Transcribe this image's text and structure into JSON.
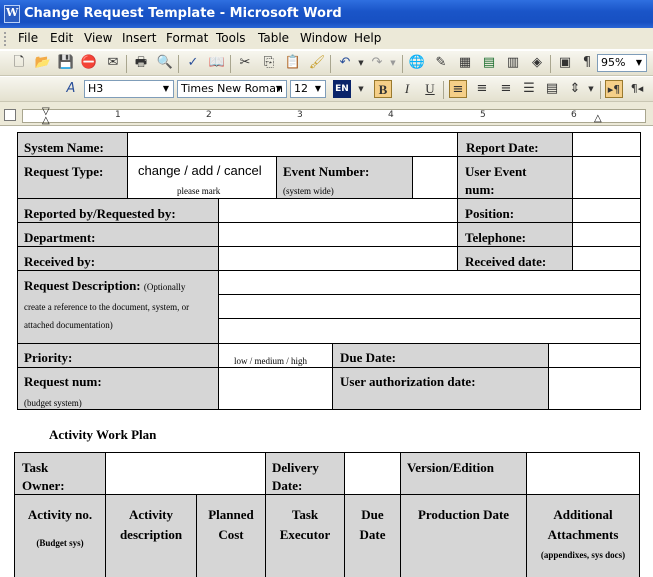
{
  "window": {
    "title": "Change Request Template - Microsoft Word"
  },
  "menu": [
    "File",
    "Edit",
    "View",
    "Insert",
    "Format",
    "Tools",
    "Table",
    "Window",
    "Help"
  ],
  "toolbar_standard": {
    "zoom": "95%"
  },
  "toolbar_format": {
    "style": "H3",
    "font": "Times New Roman",
    "size": "12",
    "language": "EN",
    "bold": "B",
    "italic": "I",
    "underline": "U"
  },
  "ruler": {
    "numbers": [
      "1",
      "2",
      "3",
      "4",
      "5",
      "6"
    ]
  },
  "form": {
    "system_name": "System Name:",
    "report_date": "Report Date:",
    "request_type": "Request Type:",
    "request_type_options": "change / add / cancel",
    "please_mark": "please mark",
    "event_number": "Event Number:",
    "system_wide": "(system wide)",
    "user_event_num_1": "User Event",
    "user_event_num_2": "num:",
    "reported_by": "Reported by/Requested by:",
    "position": "Position:",
    "department": "Department:",
    "telephone": "Telephone:",
    "received_by": "Received by:",
    "received_date": "Received date:",
    "request_description": "Request Description:",
    "request_description_note_1": "(Optionally",
    "request_description_note_2": "create a reference to the document, system, or",
    "request_description_note_3": "attached documentation)",
    "priority": "Priority:",
    "priority_options": "low / medium / high",
    "due_date": "Due Date:",
    "request_num": "Request num:",
    "budget_system": "(budget system)",
    "user_authorization_date": "User authorization date:"
  },
  "activity": {
    "heading": "Activity Work Plan",
    "task_owner_1": "Task",
    "task_owner_2": "Owner:",
    "delivery_date_1": "Delivery",
    "delivery_date_2": "Date:",
    "version_edition": "Version/Edition",
    "col_activity_no": "Activity no.",
    "col_budget_sys": "(Budget sys)",
    "col_activity_desc_1": "Activity",
    "col_activity_desc_2": "description",
    "col_planned_cost_1": "Planned",
    "col_planned_cost_2": "Cost",
    "col_task_executor_1": "Task",
    "col_task_executor_2": "Executor",
    "col_due_date_1": "Due",
    "col_due_date_2": "Date",
    "col_production_date": "Production Date",
    "col_additional_1": "Additional",
    "col_additional_2": "Attachments",
    "col_additional_3": "(appendixes, sys docs)"
  }
}
